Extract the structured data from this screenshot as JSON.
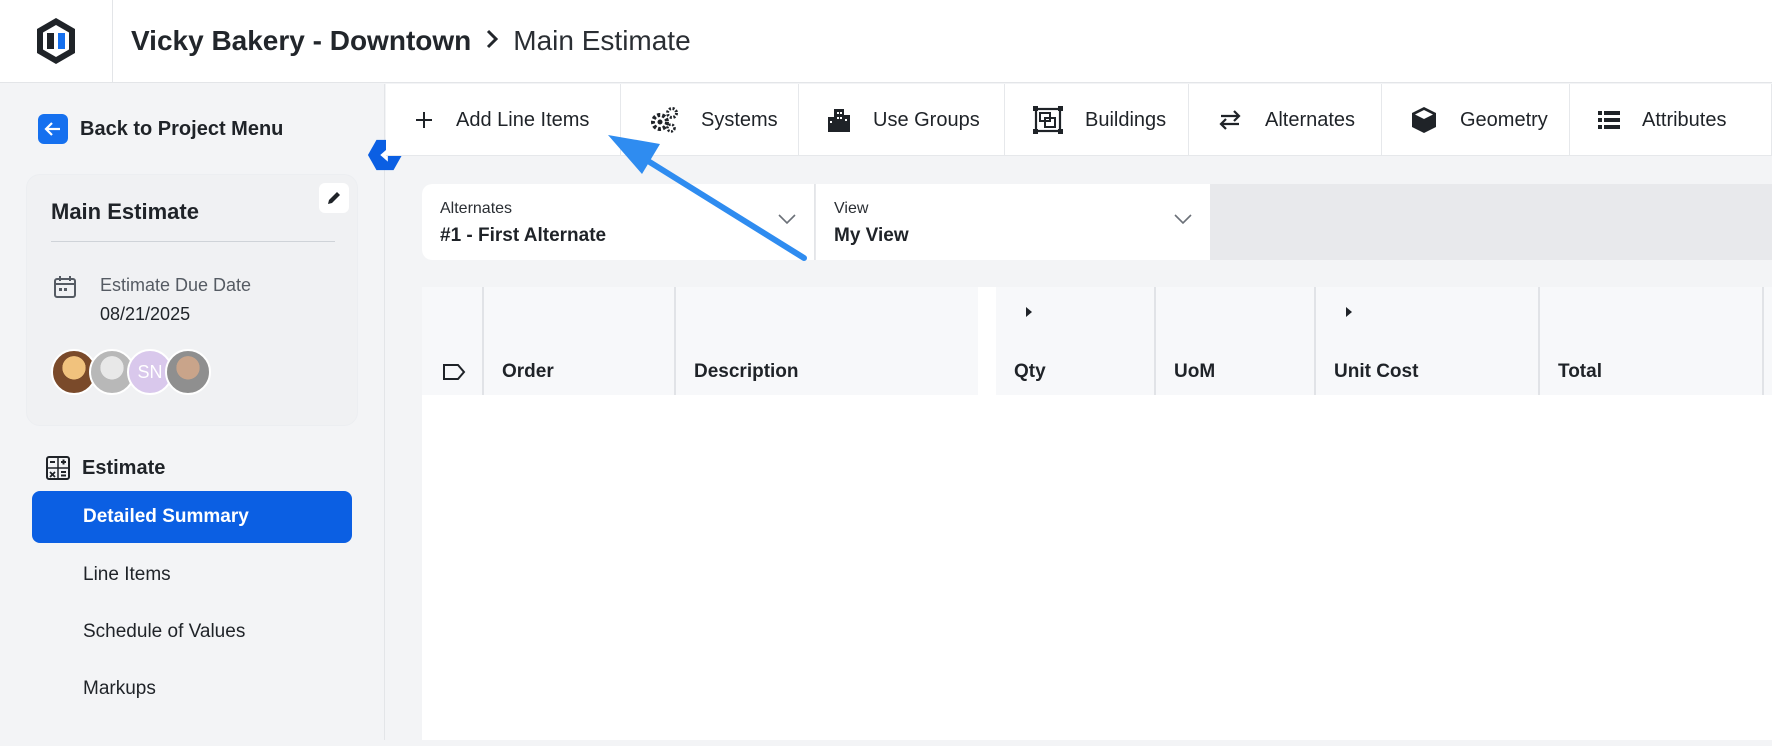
{
  "header": {
    "project": "Vicky Bakery - Downtown",
    "separator": ">",
    "current": "Main Estimate"
  },
  "sidebar": {
    "back_label": "Back to Project Menu",
    "card": {
      "title": "Main Estimate",
      "due_label": "Estimate Due Date",
      "due_value": "08/21/2025",
      "avatars": [
        "",
        "",
        "SN",
        ""
      ]
    },
    "section_label": "Estimate",
    "items": [
      {
        "label": "Detailed Summary",
        "active": true
      },
      {
        "label": "Line Items",
        "active": false
      },
      {
        "label": "Schedule of Values",
        "active": false
      },
      {
        "label": "Markups",
        "active": false
      }
    ]
  },
  "toolbar": {
    "items": [
      {
        "label": "Add Line Items",
        "icon": "plus-icon"
      },
      {
        "label": "Systems",
        "icon": "gears-icon"
      },
      {
        "label": "Use Groups",
        "icon": "building-icon"
      },
      {
        "label": "Buildings",
        "icon": "frame-icon"
      },
      {
        "label": "Alternates",
        "icon": "swap-arrows-icon"
      },
      {
        "label": "Geometry",
        "icon": "cube-icon"
      },
      {
        "label": "Attributes",
        "icon": "list-icon"
      }
    ]
  },
  "filters": {
    "alternates": {
      "label": "Alternates",
      "value": "#1 - First Alternate"
    },
    "view": {
      "label": "View",
      "value": "My View"
    }
  },
  "table": {
    "columns": [
      "Order",
      "Description",
      "Qty",
      "UoM",
      "Unit Cost",
      "Total"
    ]
  },
  "colors": {
    "primary": "#0b5fe3",
    "annotation_arrow": "#2f8cf0"
  }
}
